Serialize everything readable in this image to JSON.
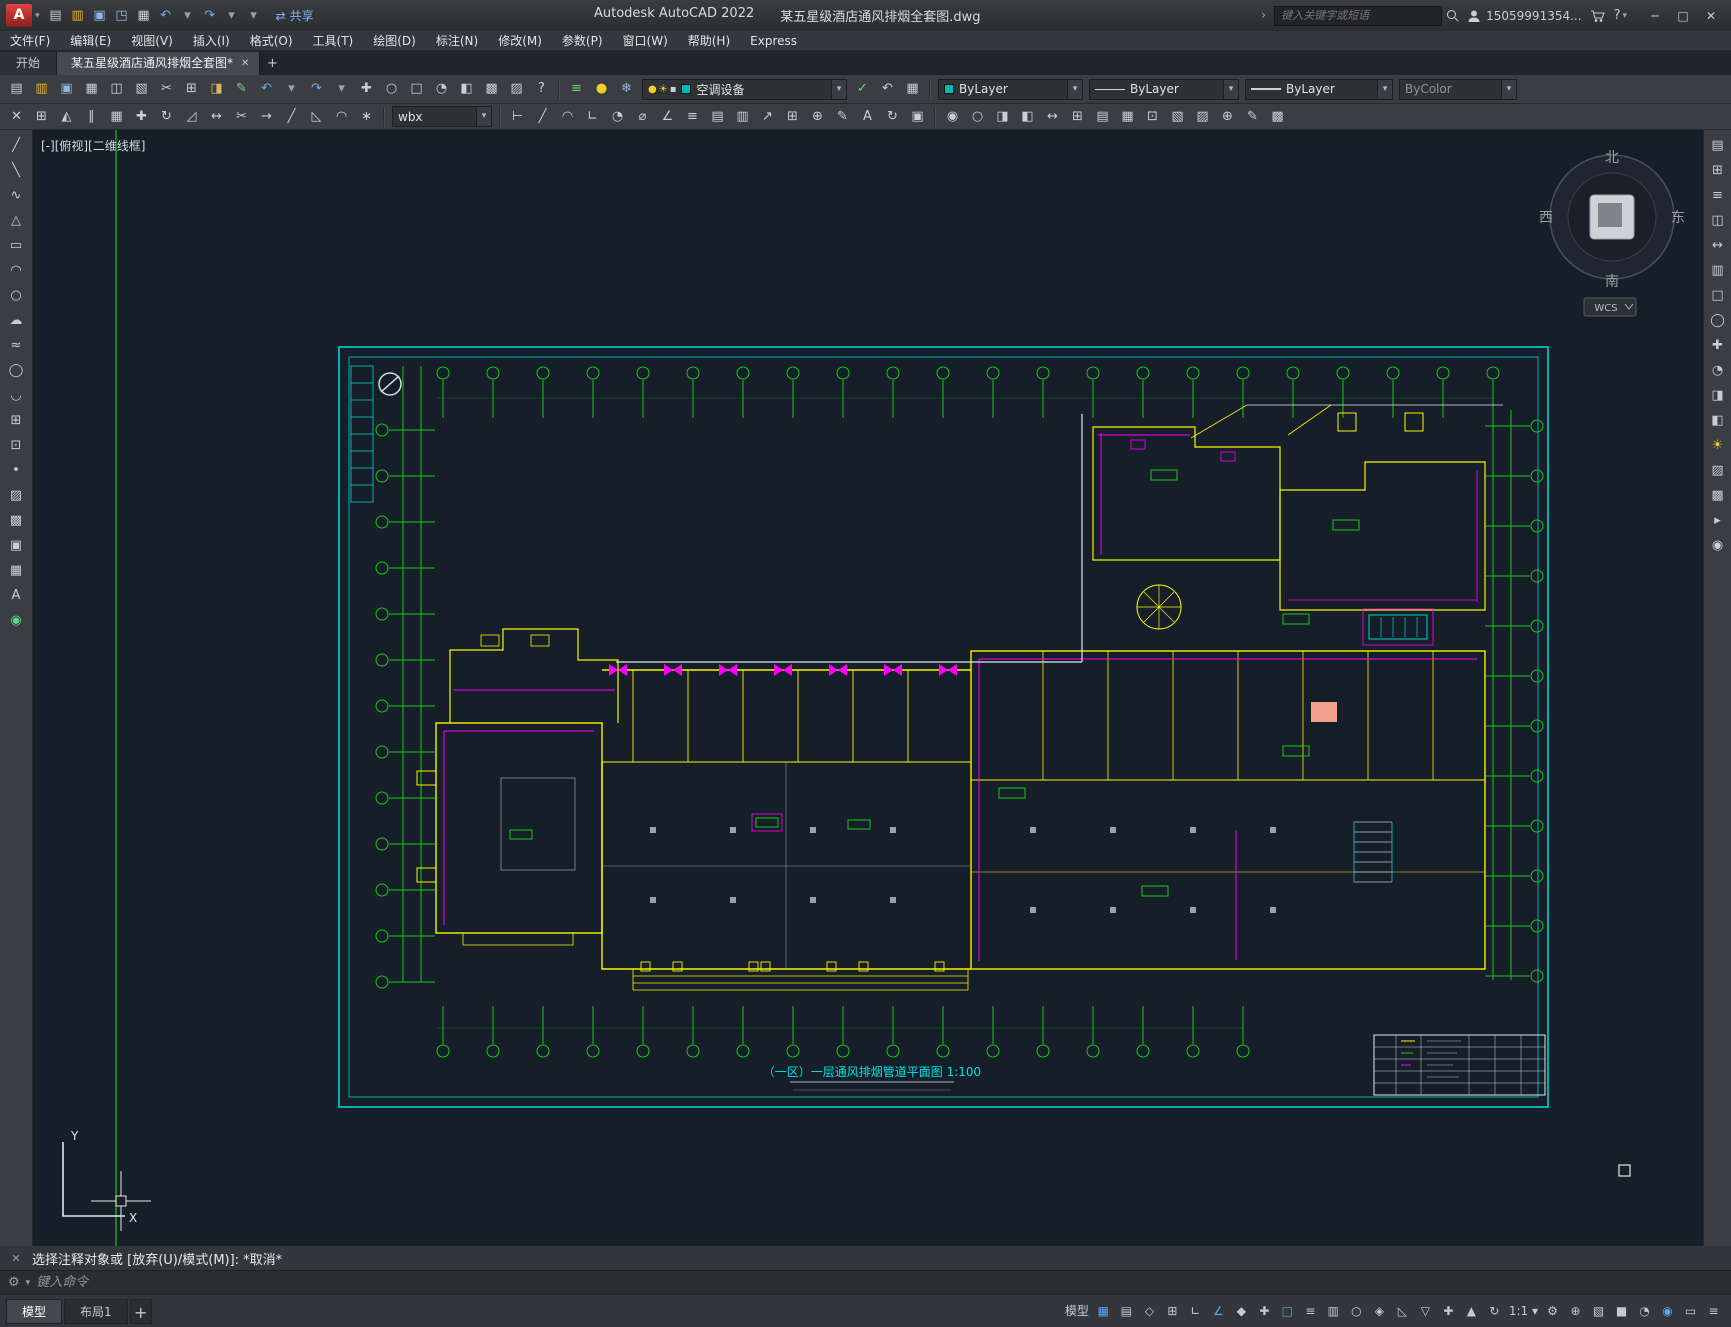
{
  "icons": {
    "app_logo": "A",
    "dropdown": "▾",
    "close": "✕",
    "minimize": "─",
    "maximize": "□",
    "help": "?",
    "chevron": "›",
    "plus": "+",
    "share_glyph": "⇄",
    "command_close": "✕",
    "command_customize": "⚙",
    "tab_close": "✕"
  },
  "titlebar": {
    "app_title": "Autodesk AutoCAD 2022",
    "doc_title": "某五星级酒店通风排烟全套图.dwg",
    "share": "共享",
    "search_placeholder": "键入关键字或短语",
    "account": "15059991354...",
    "qat": [
      {
        "name": "qat-new-button",
        "glyph": "▤",
        "color": "#c9ced3"
      },
      {
        "name": "qat-open-button",
        "glyph": "▥",
        "color": "#e3b23c"
      },
      {
        "name": "qat-save-button",
        "glyph": "▣",
        "color": "#8fb6e0"
      },
      {
        "name": "qat-saveas-button",
        "glyph": "◳",
        "color": "#8fb6e0"
      },
      {
        "name": "qat-plot-button",
        "glyph": "▦",
        "color": "#c9ced3"
      },
      {
        "name": "qat-undo-button",
        "glyph": "↶",
        "color": "#6fa8e8"
      },
      {
        "name": "qat-undo-dropdown",
        "glyph": "▾",
        "color": "#9aa0a6"
      },
      {
        "name": "qat-redo-button",
        "glyph": "↷",
        "color": "#6fa8e8"
      },
      {
        "name": "qat-redo-dropdown",
        "glyph": "▾",
        "color": "#9aa0a6"
      },
      {
        "name": "qat-customize-dropdown",
        "glyph": "▾",
        "color": "#9aa0a6"
      }
    ]
  },
  "menubar": {
    "items": [
      "文件(F)",
      "编辑(E)",
      "视图(V)",
      "插入(I)",
      "格式(O)",
      "工具(T)",
      "绘图(D)",
      "标注(N)",
      "修改(M)",
      "参数(P)",
      "窗口(W)",
      "帮助(H)",
      "Express"
    ]
  },
  "tabs": {
    "start": "开始",
    "doc": "某五星级酒店通风排烟全套图*"
  },
  "toolbar1": {
    "std_icons": [
      {
        "name": "new-button",
        "glyph": "▤"
      },
      {
        "name": "open-button",
        "glyph": "▥",
        "color": "#e3b23c"
      },
      {
        "name": "save-button",
        "glyph": "▣",
        "color": "#8fb6e0"
      },
      {
        "name": "plot-button",
        "glyph": "▦"
      },
      {
        "name": "plot-preview-button",
        "glyph": "◫"
      },
      {
        "name": "publish-button",
        "glyph": "▧"
      },
      {
        "name": "cut-button",
        "glyph": "✂"
      },
      {
        "name": "copy-button",
        "glyph": "⊞"
      },
      {
        "name": "paste-button",
        "glyph": "◨",
        "color": "#d8b56a"
      },
      {
        "name": "match-properties-button",
        "glyph": "✎",
        "color": "#7fc97f"
      },
      {
        "name": "undo-button",
        "glyph": "↶",
        "color": "#6fa8e8"
      },
      {
        "name": "undo-dropdown",
        "glyph": "▾",
        "color": "#9aa0a6"
      },
      {
        "name": "redo-button",
        "glyph": "↷",
        "color": "#6fa8e8"
      },
      {
        "name": "redo-dropdown",
        "glyph": "▾",
        "color": "#9aa0a6"
      },
      {
        "name": "pan-button",
        "glyph": "✚"
      },
      {
        "name": "zoom-realtime-button",
        "glyph": "○"
      },
      {
        "name": "zoom-window-button",
        "glyph": "□"
      },
      {
        "name": "zoom-previous-button",
        "glyph": "◔"
      },
      {
        "name": "properties-palette-button",
        "glyph": "◧"
      },
      {
        "name": "designcenter-button",
        "glyph": "▩"
      },
      {
        "name": "toolpalettes-button",
        "glyph": "▨"
      },
      {
        "name": "help-button",
        "glyph": "?"
      }
    ],
    "layer_icons": [
      {
        "name": "layer-properties-manager-button",
        "glyph": "≡",
        "color": "#7fc97f"
      },
      {
        "name": "layer-off-button",
        "glyph": "●",
        "color": "#f2d026"
      },
      {
        "name": "layer-freeze-button",
        "glyph": "❄",
        "color": "#8fb6e0"
      }
    ],
    "layer_combo": {
      "value": "空调设备",
      "chips": [
        {
          "name": "layer-on-icon",
          "glyph": "●",
          "color": "#f2d026"
        },
        {
          "name": "layer-thaw-icon",
          "glyph": "☀",
          "color": "#f2d026"
        },
        {
          "name": "layer-lock-icon",
          "glyph": "▪",
          "color": "#c9ced3"
        }
      ]
    },
    "layer_tools": [
      {
        "name": "make-object-layer-current-button",
        "glyph": "✓",
        "color": "#7fc97f"
      },
      {
        "name": "layer-previous-button",
        "glyph": "↶",
        "color": "#c9ced3"
      },
      {
        "name": "layer-states-button",
        "glyph": "▦",
        "color": "#c9ced3"
      }
    ],
    "color_combo": "ByLayer",
    "linetype_combo": "ByLayer",
    "lineweight_combo": "ByLayer",
    "plotstyle_combo": "ByColor"
  },
  "toolbar2": {
    "modify_icons": [
      {
        "name": "erase-button",
        "glyph": "✕"
      },
      {
        "name": "copy-object-button",
        "glyph": "⊞"
      },
      {
        "name": "mirror-button",
        "glyph": "◭"
      },
      {
        "name": "offset-button",
        "glyph": "∥"
      },
      {
        "name": "array-button",
        "glyph": "▦"
      },
      {
        "name": "move-button",
        "glyph": "✚"
      },
      {
        "name": "rotate-button",
        "glyph": "↻"
      },
      {
        "name": "scale-button",
        "glyph": "◿"
      },
      {
        "name": "stretch-button",
        "glyph": "↔"
      },
      {
        "name": "trim-button",
        "glyph": "✂"
      },
      {
        "name": "extend-button",
        "glyph": "→"
      },
      {
        "name": "break-button",
        "glyph": "╱"
      },
      {
        "name": "chamfer-button",
        "glyph": "◺"
      },
      {
        "name": "fillet-button",
        "glyph": "◠"
      },
      {
        "name": "explode-button",
        "glyph": "∗"
      }
    ],
    "textstyle_combo": "wbx",
    "dim_icons": [
      {
        "name": "dim-linear-button",
        "glyph": "⊢"
      },
      {
        "name": "dim-aligned-button",
        "glyph": "╱"
      },
      {
        "name": "dim-arc-length-button",
        "glyph": "◠"
      },
      {
        "name": "dim-ordinate-button",
        "glyph": "∟"
      },
      {
        "name": "dim-radius-button",
        "glyph": "◔"
      },
      {
        "name": "dim-diameter-button",
        "glyph": "⌀"
      },
      {
        "name": "dim-angular-button",
        "glyph": "∠"
      },
      {
        "name": "quick-dim-button",
        "glyph": "≡"
      },
      {
        "name": "dim-baseline-button",
        "glyph": "▤"
      },
      {
        "name": "dim-continue-button",
        "glyph": "▥"
      },
      {
        "name": "multileader-button",
        "glyph": "↗"
      },
      {
        "name": "tolerance-button",
        "glyph": "⊞"
      },
      {
        "name": "center-mark-button",
        "glyph": "⊕"
      },
      {
        "name": "dim-edit-button",
        "glyph": "✎"
      },
      {
        "name": "dim-text-edit-button",
        "glyph": "A"
      },
      {
        "name": "dim-update-button",
        "glyph": "↻"
      },
      {
        "name": "dim-style-button",
        "glyph": "▣"
      }
    ],
    "extra_icons": [
      {
        "name": "group-button",
        "glyph": "◉"
      },
      {
        "name": "ungroup-button",
        "glyph": "○"
      },
      {
        "name": "draw-order-front-button",
        "glyph": "◨"
      },
      {
        "name": "draw-order-back-button",
        "glyph": "◧"
      },
      {
        "name": "measure-button",
        "glyph": "↔"
      },
      {
        "name": "quickcalc-button",
        "glyph": "⊞"
      },
      {
        "name": "field-button",
        "glyph": "▤"
      },
      {
        "name": "table-button",
        "glyph": "▦"
      },
      {
        "name": "block-editor-button",
        "glyph": "⊡"
      },
      {
        "name": "xref-attach-button",
        "glyph": "▧"
      },
      {
        "name": "image-attach-button",
        "glyph": "▨"
      },
      {
        "name": "hyperlink-button",
        "glyph": "⊕"
      },
      {
        "name": "markup-button",
        "glyph": "✎"
      },
      {
        "name": "render-button",
        "glyph": "▩"
      }
    ]
  },
  "left_toolbar": {
    "icons": [
      {
        "name": "line-button",
        "glyph": "╱"
      },
      {
        "name": "construction-line-button",
        "glyph": "╲"
      },
      {
        "name": "polyline-button",
        "glyph": "∿"
      },
      {
        "name": "polygon-button",
        "glyph": "△"
      },
      {
        "name": "rectangle-button",
        "glyph": "▭"
      },
      {
        "name": "arc-button",
        "glyph": "◠"
      },
      {
        "name": "circle-button",
        "glyph": "○"
      },
      {
        "name": "revision-cloud-button",
        "glyph": "☁"
      },
      {
        "name": "spline-button",
        "glyph": "≈"
      },
      {
        "name": "ellipse-button",
        "glyph": "◯"
      },
      {
        "name": "ellipse-arc-button",
        "glyph": "◡"
      },
      {
        "name": "insert-block-button",
        "glyph": "⊞"
      },
      {
        "name": "make-block-button",
        "glyph": "⊡"
      },
      {
        "name": "point-button",
        "glyph": "•"
      },
      {
        "name": "hatch-button",
        "glyph": "▨"
      },
      {
        "name": "gradient-button",
        "glyph": "▩"
      },
      {
        "name": "region-button",
        "glyph": "▣"
      },
      {
        "name": "table-tool-button",
        "glyph": "▦"
      },
      {
        "name": "mtext-button",
        "glyph": "A"
      },
      {
        "name": "addselected-button",
        "glyph": "◉",
        "color": "#58d68d"
      }
    ]
  },
  "right_toolbar": {
    "icons": [
      {
        "name": "properties-tool-button",
        "glyph": "▤"
      },
      {
        "name": "blocks-palette-button",
        "glyph": "⊞"
      },
      {
        "name": "layers-palette-button",
        "glyph": "≡"
      },
      {
        "name": "groups-tool-button",
        "glyph": "◫"
      },
      {
        "name": "measure-tool-button",
        "glyph": "↔"
      },
      {
        "name": "paste-special-button",
        "glyph": "▥"
      },
      {
        "name": "zoom-window-tool-button",
        "glyph": "□"
      },
      {
        "name": "zoom-extents-button",
        "glyph": "◯"
      },
      {
        "name": "pan-tool-button",
        "glyph": "✚"
      },
      {
        "name": "orbit-button",
        "glyph": "◔"
      },
      {
        "name": "section-plane-button",
        "glyph": "◨"
      },
      {
        "name": "camera-button",
        "glyph": "◧"
      },
      {
        "name": "sun-properties-button",
        "glyph": "☀",
        "color": "#f2d026"
      },
      {
        "name": "materials-button",
        "glyph": "▨"
      },
      {
        "name": "render-tool-button",
        "glyph": "▩"
      },
      {
        "name": "show-motion-button",
        "glyph": "▸"
      },
      {
        "name": "steering-wheel-button",
        "glyph": "◉"
      }
    ]
  },
  "canvas": {
    "viewport_label": "[-][俯视][二维线框]",
    "wcs": "WCS",
    "compass": {
      "n": "北",
      "s": "南",
      "w": "西",
      "e": "东"
    },
    "drawing_title": "（一区）一层通风排烟管道平面图 1:100",
    "ucs": {
      "x": "X",
      "y": "Y"
    }
  },
  "cmd": {
    "history": "选择注释对象或 [放弃(U)/模式(M)]: *取消*",
    "placeholder": "键入命令"
  },
  "statusbar": {
    "layout_tabs": [
      {
        "name": "model-tab",
        "label": "模型",
        "active": true
      },
      {
        "name": "layout1-tab",
        "label": "布局1"
      }
    ],
    "new_layout": "+",
    "icons": [
      {
        "name": "model-paper-toggle-button",
        "glyph": "模型"
      },
      {
        "name": "grid-display-button",
        "glyph": "▦",
        "active": true
      },
      {
        "name": "snap-mode-button",
        "glyph": "▤"
      },
      {
        "name": "infer-constraints-button",
        "glyph": "◇"
      },
      {
        "name": "dynamic-input-button",
        "glyph": "⊞"
      },
      {
        "name": "ortho-mode-button",
        "glyph": "∟"
      },
      {
        "name": "polar-tracking-button",
        "glyph": "∠",
        "active": true
      },
      {
        "name": "isometric-drafting-button",
        "glyph": "◆"
      },
      {
        "name": "object-snap-tracking-button",
        "glyph": "✚"
      },
      {
        "name": "object-snap-button",
        "glyph": "□",
        "active": true
      },
      {
        "name": "lineweight-display-button",
        "glyph": "≡"
      },
      {
        "name": "transparency-button",
        "glyph": "▥"
      },
      {
        "name": "selection-cycling-button",
        "glyph": "○"
      },
      {
        "name": "3d-object-snap-button",
        "glyph": "◈"
      },
      {
        "name": "dynamic-ucs-button",
        "glyph": "◺"
      },
      {
        "name": "selection-filter-button",
        "glyph": "▽"
      },
      {
        "name": "gizmo-button",
        "glyph": "✚"
      },
      {
        "name": "annotation-visibility-button",
        "glyph": "▲"
      },
      {
        "name": "annotation-autoscale-button",
        "glyph": "↻"
      },
      {
        "name": "annotation-scale-button",
        "glyph": "1:1 ▾"
      },
      {
        "name": "workspace-switching-button",
        "glyph": "⚙"
      },
      {
        "name": "annotation-monitor-button",
        "glyph": "⊕"
      },
      {
        "name": "quick-properties-button",
        "glyph": "▧"
      },
      {
        "name": "lock-ui-button",
        "glyph": "■"
      },
      {
        "name": "isolate-objects-button",
        "glyph": "◔"
      },
      {
        "name": "graphics-performance-button",
        "glyph": "◉",
        "active": true
      },
      {
        "name": "clean-screen-button",
        "glyph": "▭"
      },
      {
        "name": "customize-button",
        "glyph": "≡"
      }
    ]
  }
}
